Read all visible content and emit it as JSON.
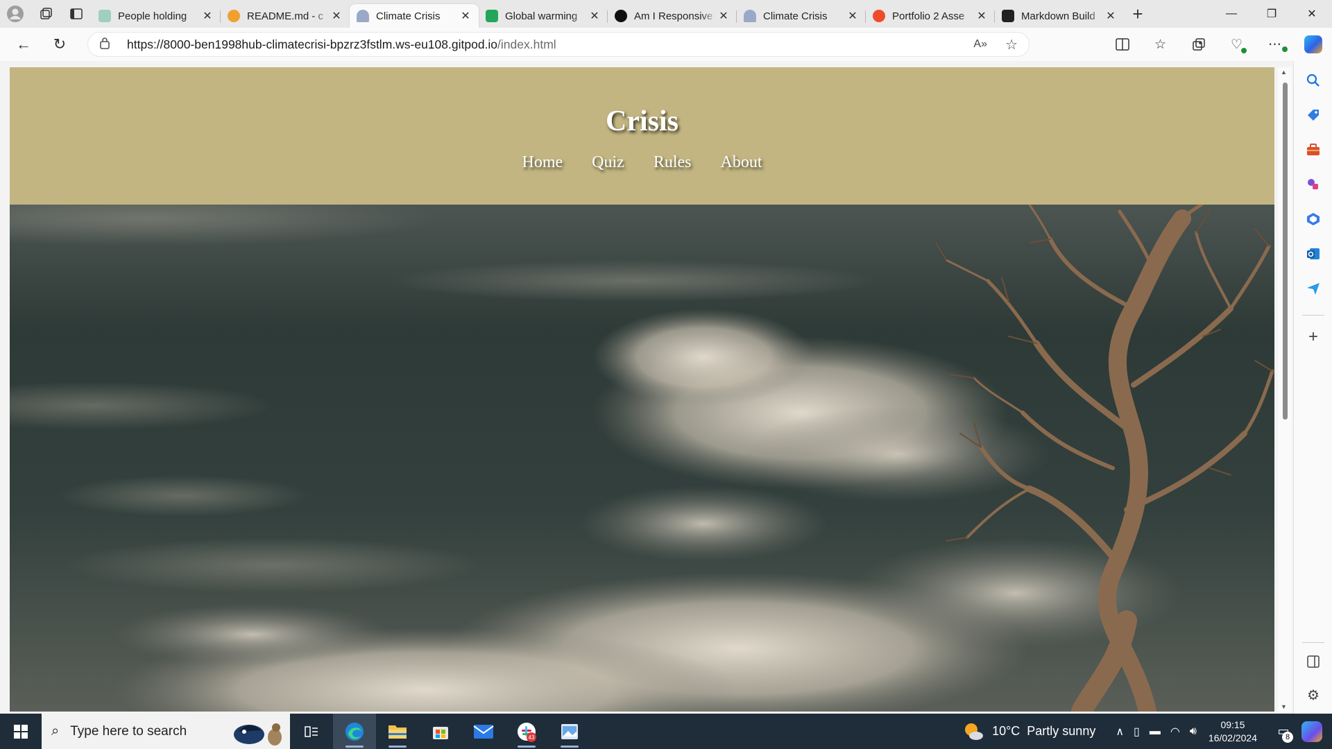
{
  "browser": {
    "tabs": [
      {
        "title": "People holding",
        "favicon_color": "#9fcfbd",
        "active": false
      },
      {
        "title": "README.md - c",
        "favicon_color": "#f0a030",
        "active": false
      },
      {
        "title": "Climate Crisis",
        "favicon_color": "#9aa9c8",
        "active": true
      },
      {
        "title": "Global warming",
        "favicon_color": "#23a55a",
        "active": false
      },
      {
        "title": "Am I Responsive",
        "favicon_color": "#111111",
        "active": false
      },
      {
        "title": "Climate Crisis",
        "favicon_color": "#9aa9c8",
        "active": false
      },
      {
        "title": "Portfolio 2 Asse",
        "favicon_color": "#f04a2a",
        "active": false
      },
      {
        "title": "Markdown Build",
        "favicon_color": "#222222",
        "active": false
      }
    ],
    "tab_close_glyph": "✕",
    "new_tab_glyph": "+",
    "url_host": "https://8000-ben1998hub-climatecrisi-bpzrz3fstlm.ws-eu108.gitpod.io",
    "url_path": "/index.html",
    "read_aloud_label": "A»"
  },
  "site": {
    "title": "Crisis",
    "nav": [
      "Home",
      "Quiz",
      "Rules",
      "About"
    ],
    "header_color": "#c2b581"
  },
  "taskbar": {
    "search_placeholder": "Type here to search",
    "weather_temp": "10°C",
    "weather_text": "Partly sunny",
    "time": "09:15",
    "date": "16/02/2024",
    "notification_count": "8",
    "slack_badge": "43"
  }
}
